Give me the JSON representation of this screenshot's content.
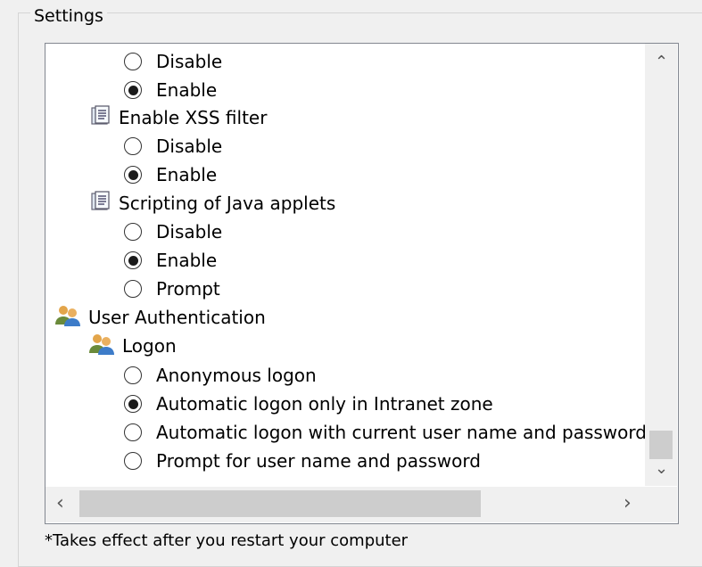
{
  "group": {
    "title": "Settings"
  },
  "items": {
    "xss_disable": "Disable",
    "xss_enable": "Enable",
    "xss_filter": "Enable XSS filter",
    "xss_filter_disable": "Disable",
    "xss_filter_enable": "Enable",
    "java_applets": "Scripting of Java applets",
    "java_disable": "Disable",
    "java_enable": "Enable",
    "java_prompt": "Prompt",
    "user_auth": "User Authentication",
    "logon": "Logon",
    "logon_anonymous": "Anonymous logon",
    "logon_intranet": "Automatic logon only in Intranet zone",
    "logon_current_user": "Automatic logon with current user name and password",
    "logon_prompt": "Prompt for user name and password"
  },
  "scroll": {
    "up": "⌃",
    "down": "⌄",
    "left": "‹",
    "right": "›"
  },
  "footnote": "*Takes effect after you restart your computer"
}
